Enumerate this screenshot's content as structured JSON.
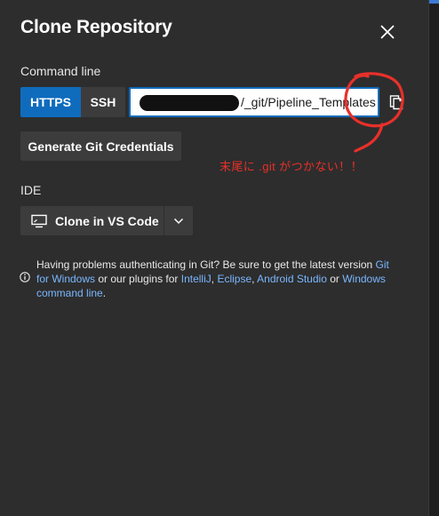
{
  "dialog": {
    "title": "Clone Repository",
    "close_icon": "close-icon"
  },
  "command_line": {
    "label": "Command line",
    "protocols": [
      {
        "label": "HTTPS",
        "selected": true
      },
      {
        "label": "SSH",
        "selected": false
      }
    ],
    "url_visible_suffix": "/_git/Pipeline_Templates",
    "copy_icon": "copy-icon"
  },
  "credentials": {
    "button_label": "Generate Git Credentials"
  },
  "ide": {
    "label": "IDE",
    "clone_button_label": "Clone in VS Code",
    "monitor_icon": "monitor-icon",
    "dropdown_icon": "chevron-down-icon"
  },
  "help": {
    "text_1": "Having problems authenticating in Git? Be sure to get the latest version ",
    "link_git_windows": "Git for Windows",
    "text_2": " or our plugins for ",
    "link_intellij": "IntelliJ",
    "sep_1": ", ",
    "link_eclipse": "Eclipse",
    "sep_2": ", ",
    "link_android": "Android Studio",
    "text_3": " or ",
    "link_windows_cmd": "Windows command line",
    "text_4": "."
  },
  "annotation": {
    "text": "末尾に .git がつかない！！",
    "color": "#e8302a"
  },
  "colors": {
    "background": "#2d2d2d",
    "accent": "#0f6cbd",
    "link": "#7ab7ff",
    "button": "#3c3c3c"
  }
}
